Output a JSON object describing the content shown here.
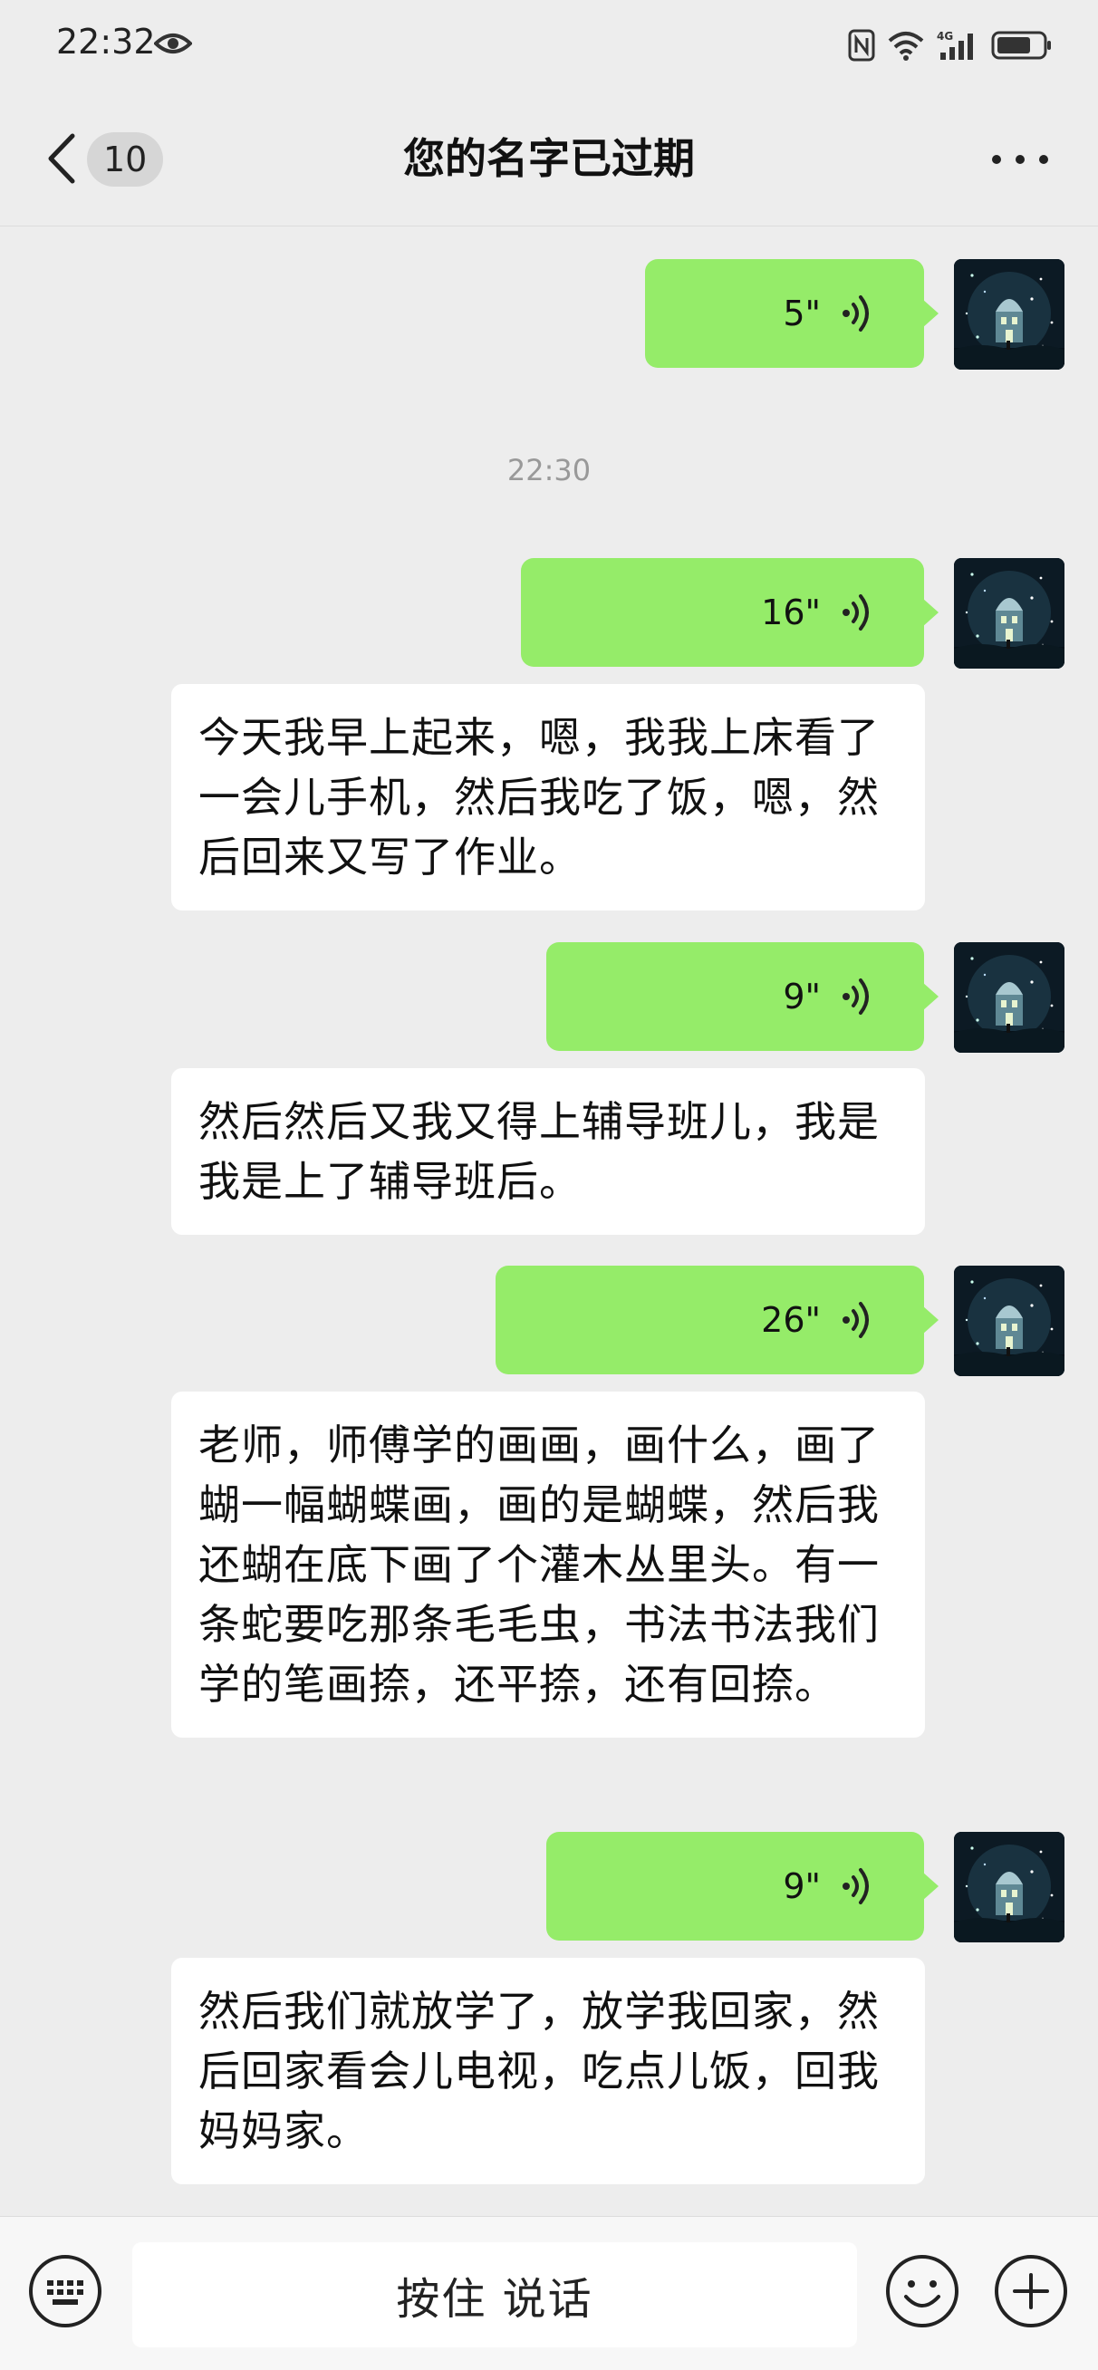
{
  "status_bar": {
    "time": "22:32",
    "icons": [
      "eye-icon",
      "nfc-icon",
      "wifi-icon",
      "4g-signal-icon",
      "battery-icon"
    ]
  },
  "header": {
    "unread_count": "10",
    "title": "您的名字已过期"
  },
  "messages": [
    {
      "type": "voice",
      "duration": "5\""
    },
    {
      "type": "timestamp",
      "text": "22:30"
    },
    {
      "type": "voice",
      "duration": "16\""
    },
    {
      "type": "transcript",
      "text": "今天我早上起来，嗯，我我上床看了一会儿手机，然后我吃了饭，嗯，然后回来又写了作业。"
    },
    {
      "type": "voice",
      "duration": "9\""
    },
    {
      "type": "transcript",
      "text": "然后然后又我又得上辅导班儿，我是我是上了辅导班后。"
    },
    {
      "type": "voice",
      "duration": "26\""
    },
    {
      "type": "transcript",
      "text": "老师，师傅学的画画，画什么，画了蝴一幅蝴蝶画，画的是蝴蝶，然后我还蝴在底下画了个灌木丛里头。有一条蛇要吃那条毛毛虫，书法书法我们学的笔画捺，还平捺，还有回捺。"
    },
    {
      "type": "voice",
      "duration": "9\""
    },
    {
      "type": "transcript",
      "text": "然后我们就放学了，放学我回家，然后回家看会儿电视，吃点儿饭，回我妈妈家。"
    }
  ],
  "input_bar": {
    "hold_to_talk_label": "按住 说话"
  },
  "colors": {
    "voice_bubble": "#95ec69",
    "background": "#ededed",
    "transcript_bubble": "#ffffff"
  }
}
